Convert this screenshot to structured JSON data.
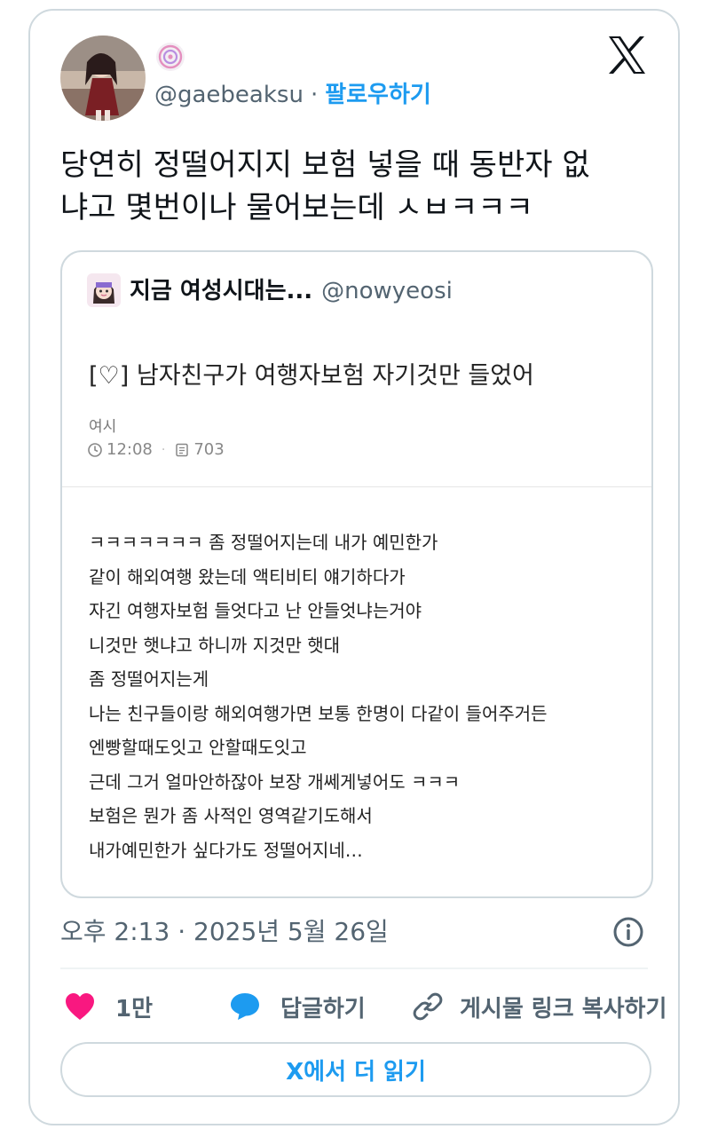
{
  "author": {
    "handle": "@gaebeaksu",
    "separator": "·",
    "follow_label": "팔로우하기"
  },
  "tweet": {
    "lines": [
      "당연히 정떨어지지 보험 넣을 때 동반자 없",
      "냐고 몇번이나 물어보는데 ㅅㅂㅋㅋㅋ"
    ],
    "timestamp": "오후 2:13 · 2025년 5월 26일"
  },
  "quote": {
    "name": "지금 여성시대는...",
    "handle": "@nowyeosi",
    "post_title": "[♡] 남자친구가 여행자보험 자기것만 들었어",
    "category": "여시",
    "time": "12:08",
    "views": "703",
    "body_lines": [
      "ㅋㅋㅋㅋㅋㅋㅋ 좀 정떨어지는데 내가 예민한가",
      "같이 해외여행 왔는데 액티비티 얘기하다가",
      "자긴 여행자보험 들엇다고 난 안들엇냐는거야",
      "니것만 햇냐고 하니까 지것만 햇대",
      "좀 정떨어지는게",
      "나는 친구들이랑 해외여행가면 보통 한명이 다같이 들어주거든",
      "엔빵할때도잇고 안할때도잇고",
      "근데 그거 얼마안하잖아 보장 개쎄게넣어도 ㅋㅋㅋ",
      "보험은 뭔가 좀 사적인 영역같기도해서",
      "내가예민한가 싶다가도 정떨어지네…"
    ]
  },
  "actions": {
    "like_count": "1만",
    "reply_label": "답글하기",
    "copy_link_label": "게시물 링크 복사하기"
  },
  "read_more_label": "X에서 더 읽기",
  "icons": {
    "badge": "spiral-badge-icon",
    "platform": "x-logo-icon",
    "info": "info-icon",
    "like": "heart-icon",
    "reply": "speech-bubble-icon",
    "link": "link-icon",
    "clock": "clock-icon",
    "views": "document-icon"
  },
  "colors": {
    "accent": "#1d9bf0",
    "like": "#f91880",
    "muted": "#536471",
    "border": "#cfd9de"
  }
}
